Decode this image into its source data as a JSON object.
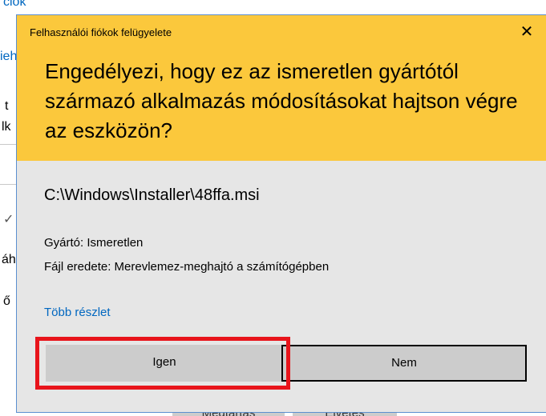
{
  "background_window": {
    "fragments": [
      "ciók",
      "ieh",
      "t",
      "lk",
      "✓",
      "áh",
      "ő"
    ],
    "bottom_buttons": [
      "Megtartás",
      "Elvetés"
    ]
  },
  "dialog": {
    "title": "Felhasználói fiókok felügyelete",
    "close_label": "✕",
    "question": "Engedélyezi, hogy ez az ismeretlen gyártótól származó alkalmazás módosításokat hajtson végre az eszközön?",
    "file_path": "C:\\Windows\\Installer\\48ffa.msi",
    "publisher": "Gyártó: Ismeretlen",
    "origin": "Fájl eredete: Merevlemez-meghajtó a számítógépben",
    "more_details": "Több részlet",
    "yes_label": "Igen",
    "no_label": "Nem",
    "colors": {
      "header": "#fbc83c",
      "body": "#e6e6e6",
      "link": "#0067c0",
      "highlight": "#e8141b"
    }
  }
}
